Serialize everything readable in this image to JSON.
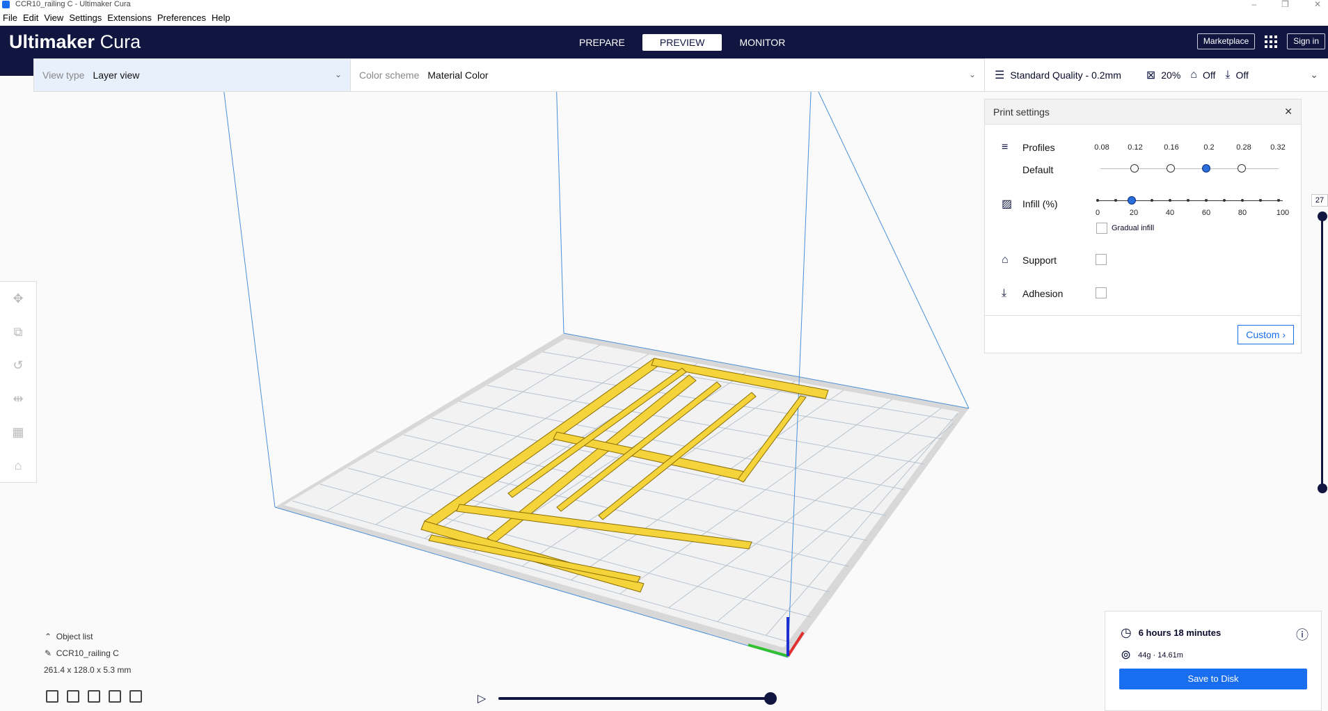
{
  "window": {
    "title": "CCR10_railing C - Ultimaker Cura",
    "min": "–",
    "max": "❐",
    "close": "✕"
  },
  "menu": [
    "File",
    "Edit",
    "View",
    "Settings",
    "Extensions",
    "Preferences",
    "Help"
  ],
  "header": {
    "logo_bold": "Ultimaker",
    "logo_light": "Cura",
    "stages": [
      "PREPARE",
      "PREVIEW",
      "MONITOR"
    ],
    "active_stage": "PREVIEW",
    "marketplace": "Marketplace",
    "signin": "Sign in"
  },
  "viewbar": {
    "view_type_label": "View type",
    "view_type_value": "Layer view",
    "color_scheme_label": "Color scheme",
    "color_scheme_value": "Material Color"
  },
  "settings_bar": {
    "profile": "Standard Quality - 0.2mm",
    "infill": "20%",
    "support": "Off",
    "adhesion": "Off"
  },
  "print_settings": {
    "title": "Print settings",
    "profiles_label": "Profiles",
    "default_label": "Default",
    "profile_ticks": [
      "0.08",
      "0.12",
      "0.16",
      "0.2",
      "0.28",
      "0.32"
    ],
    "selected_profile": "0.2",
    "infill_label": "Infill (%)",
    "infill_ticks": [
      "0",
      "20",
      "40",
      "60",
      "80",
      "100"
    ],
    "infill_value": 20,
    "gradual_infill": "Gradual infill",
    "support_label": "Support",
    "adhesion_label": "Adhesion",
    "custom_button": "Custom"
  },
  "layer_slider": {
    "top_value": "27"
  },
  "object_list": {
    "header": "Object list",
    "object_name": "CCR10_railing C",
    "dimensions": "261.4 x 128.0 x 5.3 mm"
  },
  "estimate": {
    "time": "6 hours 18 minutes",
    "material": "44g · 14.61m",
    "save_button": "Save to Disk"
  },
  "colors": {
    "header": "#10163f",
    "accent": "#196ef0",
    "model": "#f4d43a",
    "buildplate": "#f4f4f4"
  }
}
